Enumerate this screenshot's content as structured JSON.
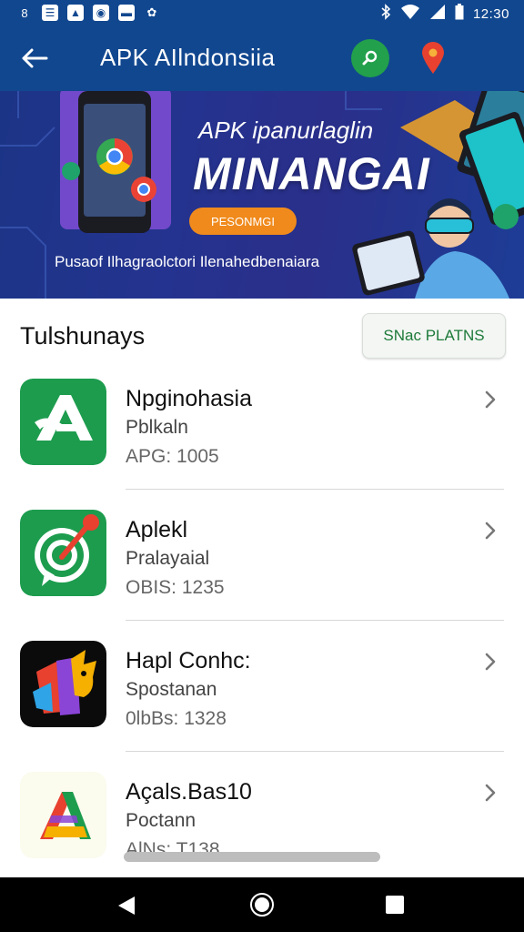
{
  "status_bar": {
    "time": "12:30",
    "left_icons": [
      "notification-icon",
      "notification-icon",
      "notification-icon",
      "notification-icon",
      "notification-icon"
    ],
    "right_icons": [
      "bluetooth-icon",
      "wifi-icon",
      "signal-icon",
      "battery-icon"
    ]
  },
  "app_bar": {
    "title": "APK  AIlndonsiia",
    "background_color": "#11478f",
    "search_color": "#22a04b",
    "location_color": "#e8412f"
  },
  "banner": {
    "heading": "APK ipanurlaglin",
    "title": "MINANGAI",
    "cta_label": "PESONMGI",
    "caption": "Pusaof Ilhagraolctori Ilenahedbenaiara",
    "cta_color": "#f08a1c"
  },
  "section": {
    "title": "Tulshunays",
    "button_label": "SNac PLATNS"
  },
  "apps": [
    {
      "name": "Npginohasia",
      "category": "Pblkaln",
      "meta": "APG: 1005",
      "icon": "green-a-app-icon"
    },
    {
      "name": "Aplekl",
      "category": "Pralayaial",
      "meta": "OBIS: 1235",
      "icon": "green-target-app-icon"
    },
    {
      "name": "Hapl Conhc:",
      "category": "Spostanan",
      "meta": "0lbBs: 1328",
      "icon": "colorful-fox-app-icon"
    },
    {
      "name": "Açals.Bas10",
      "category": "Poctann",
      "meta": "AlNs: T138",
      "icon": "colorful-a-app-icon"
    }
  ]
}
